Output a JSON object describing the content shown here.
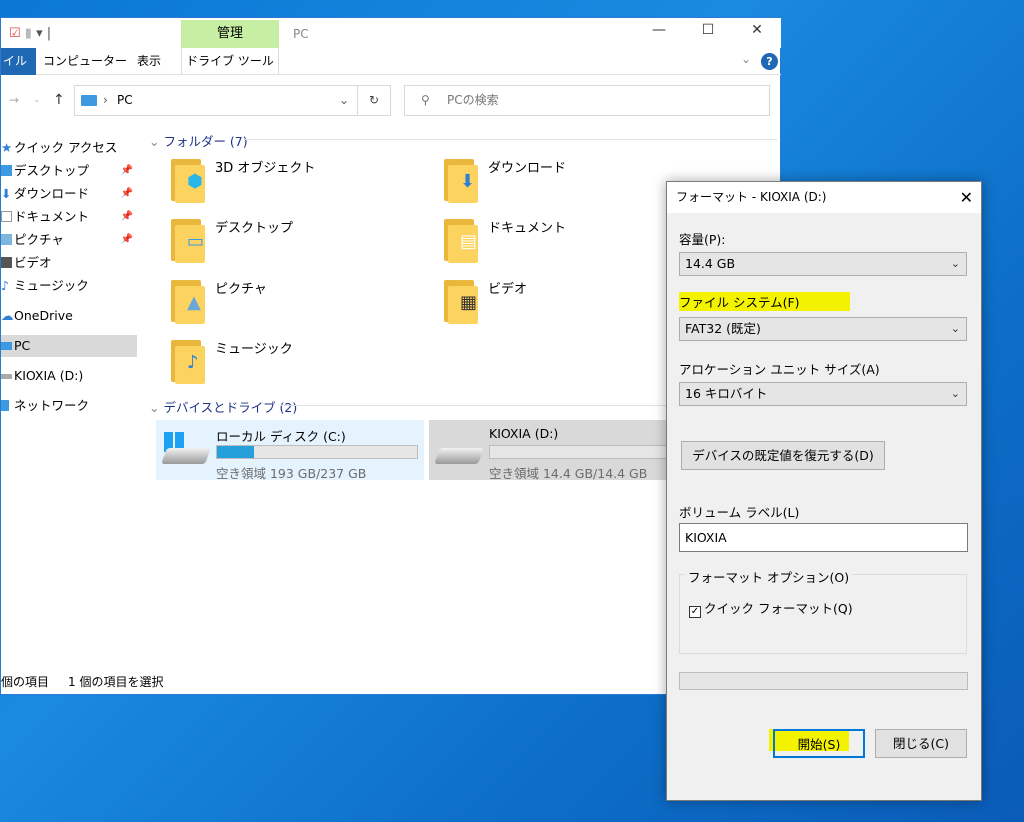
{
  "explorer": {
    "title": "PC",
    "ribbon_context_group": "管理",
    "tabs": {
      "file": "イル",
      "computer": "コンピューター",
      "view": "表示",
      "drive_tools": "ドライブ ツール"
    },
    "address": "PC",
    "search_placeholder": "PCの検索",
    "nav": {
      "quick_access": "クイック アクセス",
      "desktop": "デスクトップ",
      "downloads": "ダウンロード",
      "documents": "ドキュメント",
      "pictures": "ピクチャ",
      "videos": "ビデオ",
      "music": "ミュージック",
      "onedrive": "OneDrive",
      "pc": "PC",
      "kioxia": "KIOXIA (D:)",
      "network": "ネットワーク"
    },
    "folders_header": "フォルダー (7)",
    "folders": [
      "3D オブジェクト",
      "ダウンロード",
      "デスクトップ",
      "ドキュメント",
      "ピクチャ",
      "ビデオ",
      "ミュージック"
    ],
    "drives_header": "デバイスとドライブ (2)",
    "drives": [
      {
        "name": "ローカル ディスク (C:)",
        "free": "空き領域 193 GB/237 GB",
        "used_fraction": 0.186
      },
      {
        "name": "KIOXIA (D:)",
        "free": "空き領域 14.4 GB/14.4 GB",
        "used_fraction": 0.0
      }
    ],
    "status_items": "個の項目",
    "status_selected": "1 個の項目を選択"
  },
  "dialog": {
    "title": "フォーマット - KIOXIA (D:)",
    "capacity_label": "容量(P):",
    "capacity": "14.4 GB",
    "fs_label": "ファイル システム(F)",
    "fs": "FAT32 (既定)",
    "alloc_label": "アロケーション ユニット サイズ(A)",
    "alloc": "16 キロバイト",
    "restore_btn": "デバイスの既定値を復元する(D)",
    "volume_label": "ボリューム ラベル(L)",
    "volume": "KIOXIA",
    "options_label": "フォーマット オプション(O)",
    "quick_format": "クイック フォーマット(Q)",
    "quick_checked": true,
    "progress": 0,
    "start_btn": "開始(S)",
    "close_btn": "閉じる(C)"
  },
  "colors": {
    "highlight": "#f3f300",
    "accent": "#1e68b4",
    "drive_fill": "#26a0da"
  }
}
